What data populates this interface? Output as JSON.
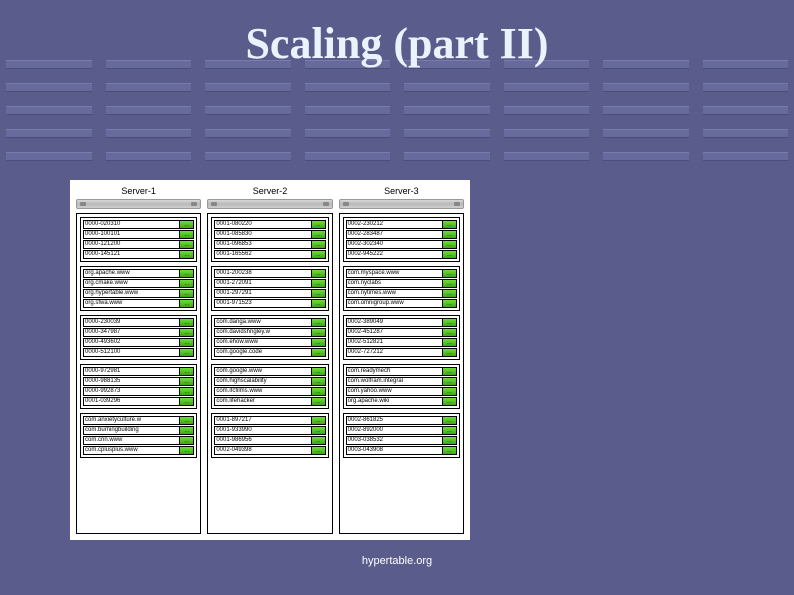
{
  "title": "Scaling (part II)",
  "footer": "hypertable.org",
  "servers": [
    {
      "name": "Server-1",
      "blocks": [
        [
          "0000-020310",
          "0000-100101",
          "0000-121200",
          "0000-145121"
        ],
        [
          "org.apache.www",
          "org.cmake.www",
          "org.hypertable.www",
          "org.sfwa.www"
        ],
        [
          "0000-230039",
          "0000-347987",
          "0000-493602",
          "0000-512100"
        ],
        [
          "0000-972981",
          "0000-988135",
          "0000-992873",
          "0001-039296"
        ],
        [
          "com.anxietyculture.w",
          "com.burningbuilding",
          "com.cnn.www",
          "com.cplusplus.www"
        ]
      ]
    },
    {
      "name": "Server-2",
      "blocks": [
        [
          "0001-080220",
          "0001-085830",
          "0001-096853",
          "0001-165562"
        ],
        [
          "0001-200238",
          "0001-272091",
          "0001-297291",
          "0001-971523"
        ],
        [
          "com.danga.www",
          "com.davidshrigley.w",
          "com.ehow.www",
          "com.google.code"
        ],
        [
          "com.google.www",
          "com.highscalability",
          "com.ifcfilms.www",
          "com.lifehacker"
        ],
        [
          "0001-897217",
          "0001-933990",
          "0001-986956",
          "0002-049398"
        ]
      ]
    },
    {
      "name": "Server-3",
      "blocks": [
        [
          "0002-230212",
          "0002-283487",
          "0002-302340",
          "0002-945222"
        ],
        [
          "com.myspace.www",
          "com.nyclabs",
          "com.nytimes.www",
          "com.omnigroup.www"
        ],
        [
          "0002-389049",
          "0002-451287",
          "0002-512821",
          "0002-727212"
        ],
        [
          "com.readymech",
          "com.wolfram.integral",
          "com.yahoo.www",
          "org.apache.wiki"
        ],
        [
          "0002-861825",
          "0002-892000",
          "0003-038532",
          "0003-043908"
        ]
      ]
    }
  ]
}
